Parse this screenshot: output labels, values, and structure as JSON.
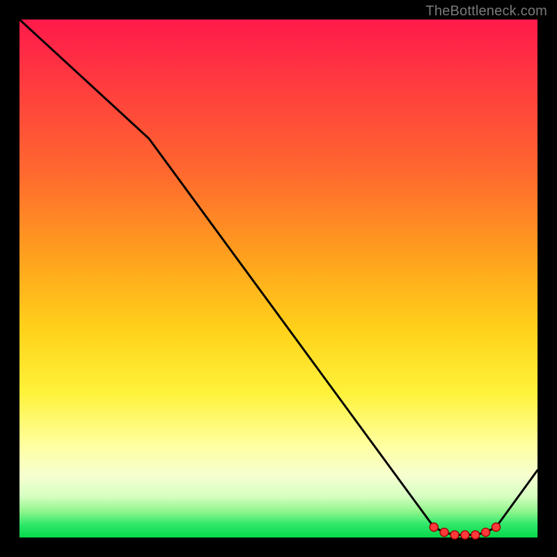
{
  "watermark": "TheBottleneck.com",
  "chart_data": {
    "type": "line",
    "title": "",
    "xlabel": "",
    "ylabel": "",
    "xlim": [
      0,
      100
    ],
    "ylim": [
      0,
      100
    ],
    "x": [
      0,
      25,
      80,
      82,
      84,
      86,
      88,
      90,
      92,
      100
    ],
    "values": [
      100,
      77,
      2,
      1,
      0.5,
      0.5,
      0.5,
      1,
      2,
      13
    ],
    "markers_x": [
      80,
      82,
      84,
      86,
      88,
      90,
      92
    ],
    "markers_y": [
      2,
      1,
      0.5,
      0.5,
      0.5,
      1,
      2
    ]
  }
}
